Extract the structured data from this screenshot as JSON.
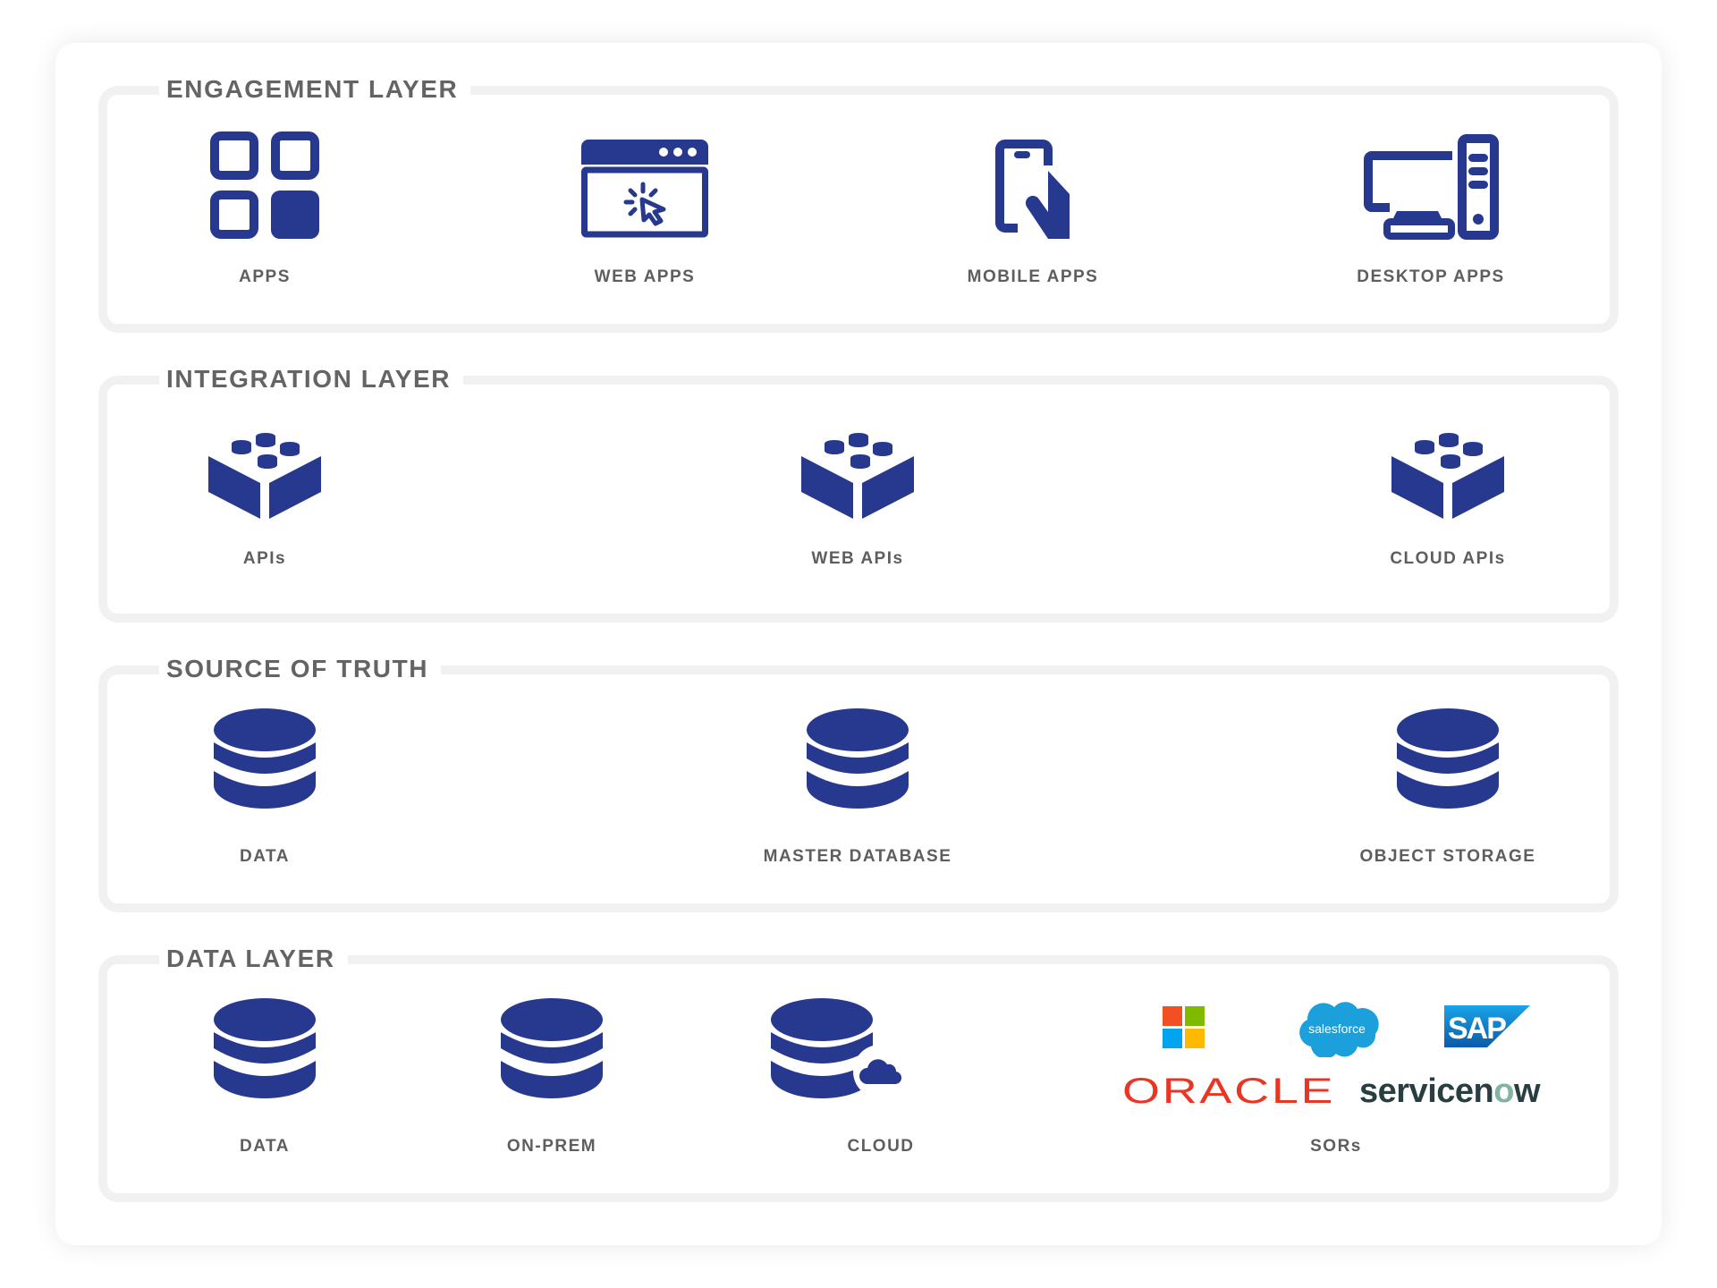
{
  "colors": {
    "icon": "#27388f",
    "title": "#646464",
    "label": "#5e5e5e",
    "frame": "#f1f1f1"
  },
  "sections": [
    {
      "title": "ENGAGEMENT LAYER",
      "items": [
        {
          "label": "APPS",
          "icon": "apps-grid-icon"
        },
        {
          "label": "WEB APPS",
          "icon": "browser-click-icon"
        },
        {
          "label": "MOBILE APPS",
          "icon": "hand-phone-icon"
        },
        {
          "label": "DESKTOP APPS",
          "icon": "desktop-computer-icon"
        }
      ]
    },
    {
      "title": "INTEGRATION LAYER",
      "items": [
        {
          "label": "APIs",
          "icon": "building-block-icon"
        },
        {
          "label": "WEB APIs",
          "icon": "building-block-icon"
        },
        {
          "label": "CLOUD APIs",
          "icon": "building-block-icon"
        }
      ]
    },
    {
      "title": "SOURCE OF TRUTH",
      "items": [
        {
          "label": "DATA",
          "icon": "database-icon"
        },
        {
          "label": "MASTER DATABASE",
          "icon": "database-icon"
        },
        {
          "label": "OBJECT STORAGE",
          "icon": "database-icon"
        }
      ]
    },
    {
      "title": "DATA LAYER",
      "items": [
        {
          "label": "DATA",
          "icon": "database-icon"
        },
        {
          "label": "ON-PREM",
          "icon": "database-icon"
        },
        {
          "label": "CLOUD",
          "icon": "database-cloud-icon"
        },
        {
          "label": "SORs",
          "icon": "vendor-logos"
        }
      ]
    }
  ],
  "logos": {
    "salesforce": "salesforce",
    "sap": "SAP",
    "oracle": "ORACLE",
    "servicenow_a": "servicen",
    "servicenow_b": "w"
  }
}
